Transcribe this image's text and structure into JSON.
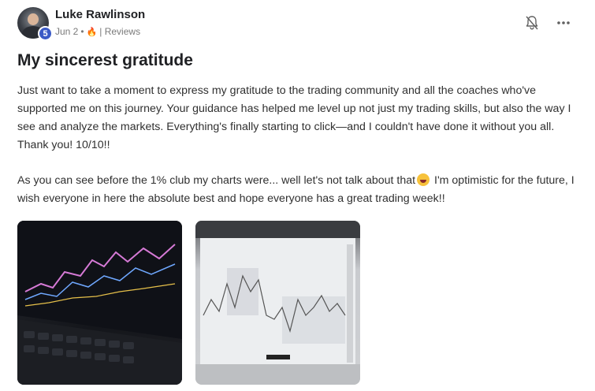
{
  "post": {
    "author": "Luke Rawlinson",
    "level": "5",
    "date": "Jun 2",
    "separator": "•",
    "category": "| Reviews",
    "title": "My sincerest gratitude",
    "paragraph1": "Just want to take a moment to express my gratitude to the trading community and all the coaches who've supported me on this journey. Your guidance has helped me level up not just my trading skills, but also the way I see and analyze the markets. Everything's finally starting to click—and I couldn't have done it without you all. Thank you! 10/10!!",
    "paragraph2_before": "As you can see before the 1% club my charts were... well let's not talk about that",
    "paragraph2_after": " I'm optimistic for the future, I wish everyone in here the absolute best and hope everyone has a great trading week!!"
  },
  "icons": {
    "level_badge": "level-badge-icon",
    "category_emoji": "fire-icon",
    "bell": "bell-off-icon",
    "more": "more-horizontal-icon",
    "laugh_emoji": "rofl-emoji-icon"
  },
  "colors": {
    "level_badge": "#3b5ac6",
    "title": "#202124",
    "body_text": "#303030",
    "meta_text": "#7a7a7a"
  }
}
